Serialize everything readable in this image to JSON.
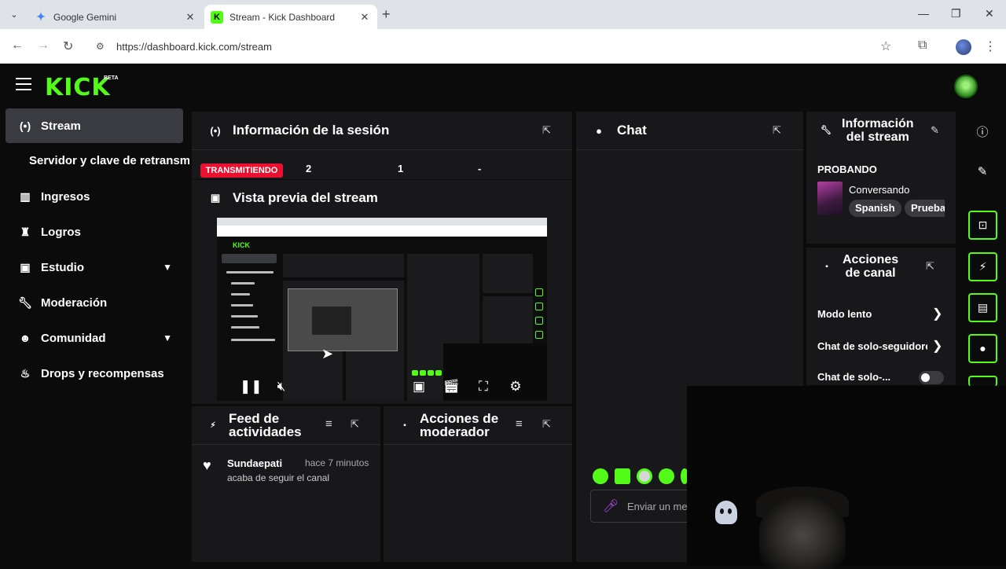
{
  "browser": {
    "tabs": [
      {
        "title": "Google Gemini",
        "active": false
      },
      {
        "title": "Stream - Kick Dashboard",
        "active": true
      }
    ],
    "url": "https://dashboard.kick.com/stream"
  },
  "header": {
    "logo": "KICK",
    "beta": "BETA"
  },
  "sidebar": {
    "items": [
      {
        "label": "Stream",
        "icon": "broadcast-icon",
        "active": true
      },
      {
        "label": "Ingresos",
        "icon": "bar-chart-icon"
      },
      {
        "label": "Logros",
        "icon": "trophy-icon"
      },
      {
        "label": "Estudio",
        "icon": "studio-icon",
        "expandable": true
      },
      {
        "label": "Moderación",
        "icon": "wrench-icon"
      },
      {
        "label": "Comunidad",
        "icon": "people-icon",
        "expandable": true
      },
      {
        "label": "Drops y recompensas",
        "icon": "drops-icon"
      }
    ],
    "sub_item": "Servidor y clave de retransmisión"
  },
  "session": {
    "title": "Información de la sesión",
    "live_badge": "TRANSMITIENDO",
    "stats": [
      "2",
      "1",
      "-"
    ]
  },
  "preview": {
    "title": "Vista previa del stream"
  },
  "feed": {
    "title_line1": "Feed de",
    "title_line2": "actividades",
    "items": [
      {
        "user": "Sundaepati",
        "time": "hace 7 minutos",
        "message": "acaba de seguir el canal"
      }
    ]
  },
  "mod_actions": {
    "title_line1": "Acciones de",
    "title_line2": "moderador"
  },
  "chat": {
    "title": "Chat",
    "placeholder": "Enviar un mensaje"
  },
  "stream_info": {
    "title_line1": "Información",
    "title_line2": "del stream",
    "stream_title": "PROBANDO",
    "category": "Conversando",
    "tags": [
      "Spanish",
      "Prueba"
    ]
  },
  "channel_actions": {
    "title_line1": "Acciones",
    "title_line2": "de canal",
    "items": [
      {
        "label": "Modo lento"
      },
      {
        "label": "Chat de solo-seguidores"
      },
      {
        "label": "Chat de solo-..."
      }
    ]
  },
  "colors": {
    "brand": "#53fc18",
    "live": "#e9112f",
    "panel": "#18181b",
    "background": "#0b0b0c"
  }
}
